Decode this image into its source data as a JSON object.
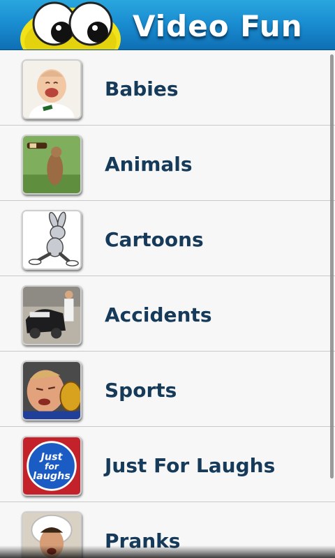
{
  "app": {
    "title": "Video Fun",
    "brand_color": "#1a8ed2"
  },
  "categories": [
    {
      "label": "Babies",
      "icon": "baby-thumbnail"
    },
    {
      "label": "Animals",
      "icon": "animal-thumbnail"
    },
    {
      "label": "Cartoons",
      "icon": "cartoon-thumbnail"
    },
    {
      "label": "Accidents",
      "icon": "accident-thumbnail"
    },
    {
      "label": "Sports",
      "icon": "sports-thumbnail"
    },
    {
      "label": "Just For Laughs",
      "icon": "just-for-laughs-thumbnail"
    },
    {
      "label": "Pranks",
      "icon": "pranks-thumbnail"
    }
  ],
  "thumb_badge": {
    "line1": "Just",
    "line2": "for",
    "line3": "laughs"
  }
}
